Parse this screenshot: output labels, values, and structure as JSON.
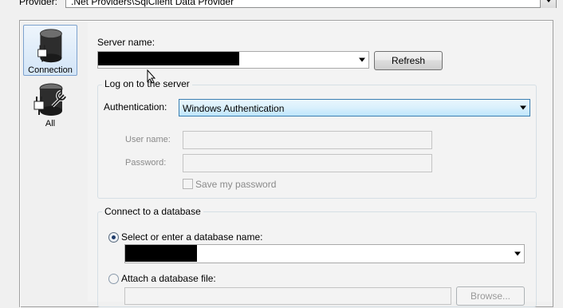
{
  "provider": {
    "label": "Provider:",
    "value": ".Net Providers\\SqlClient Data Provider"
  },
  "nav": {
    "items": [
      {
        "label": "Connection",
        "icon": "database-plug-icon",
        "selected": true
      },
      {
        "label": "All",
        "icon": "database-wrench-icon",
        "selected": false
      }
    ]
  },
  "server": {
    "label": "Server name:",
    "refresh_label": "Refresh"
  },
  "logon": {
    "title": "Log on to the server",
    "auth_label": "Authentication:",
    "auth_value": "Windows Authentication",
    "username_label": "User name:",
    "password_label": "Password:",
    "save_password_label": "Save my password"
  },
  "database": {
    "title": "Connect to a database",
    "select_option_label": "Select or enter a database name:",
    "attach_option_label": "Attach a database file:",
    "browse_label": "Browse..."
  },
  "colors": {
    "selected_nav_border": "#7da2ce",
    "redaction": "#000000"
  }
}
